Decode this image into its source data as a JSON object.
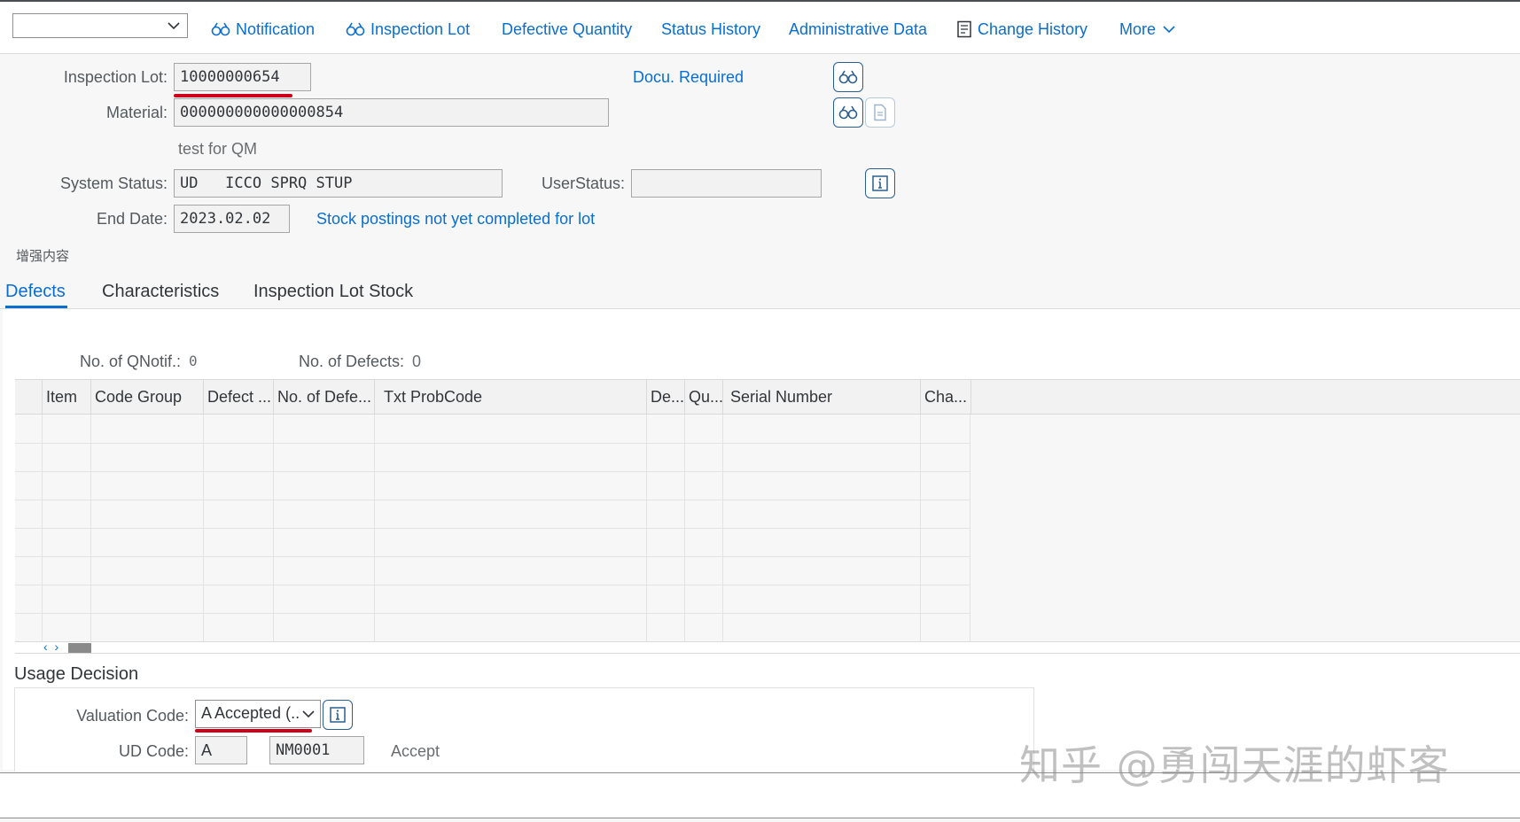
{
  "toolbar": {
    "dropdown_value": "",
    "buttons": [
      {
        "label": "Notification",
        "icon": "binoculars-icon"
      },
      {
        "label": "Inspection Lot",
        "icon": "binoculars-icon"
      },
      {
        "label": "Defective Quantity"
      },
      {
        "label": "Status History"
      },
      {
        "label": "Administrative Data"
      },
      {
        "label": "Change History",
        "icon": "change-document-icon"
      },
      {
        "label": "More",
        "icon": "chevron-down-icon"
      }
    ]
  },
  "header": {
    "inspection_lot_label": "Inspection Lot:",
    "inspection_lot_value": "10000000654",
    "docu_required_link": "Docu. Required",
    "material_label": "Material:",
    "material_value": "000000000000000854",
    "material_description": "test for QM",
    "system_status_label": "System Status:",
    "system_status_value": "UD   ICCO SPRQ STUP",
    "user_status_label": "UserStatus:",
    "user_status_value": "",
    "end_date_label": "End Date:",
    "end_date_value": "2023.02.02",
    "stock_postings_link": "Stock postings not yet completed for lot",
    "enhancement_label": "增强内容"
  },
  "tabs": [
    {
      "label": "Defects",
      "active": true
    },
    {
      "label": "Characteristics",
      "active": false
    },
    {
      "label": "Inspection Lot Stock",
      "active": false
    }
  ],
  "defects": {
    "qnotif_label": "No. of QNotif.:",
    "qnotif_value": "0",
    "defects_label": "No. of Defects:",
    "defects_value": "0",
    "columns": [
      "Item",
      "Code Group",
      "Defect ...",
      "No. of Defe...",
      "Txt ProbCode",
      "De...",
      "Qu...",
      "Serial Number",
      "Cha..."
    ],
    "rows": []
  },
  "usage_decision": {
    "title": "Usage Decision",
    "valuation_code_label": "Valuation Code:",
    "valuation_code_value": "A Accepted (...",
    "ud_code_label": "UD Code:",
    "ud_code_value": "A",
    "ud_code_group": "NM0001",
    "ud_code_text": "Accept"
  },
  "watermark": "知乎 @勇闯天涯的虾客",
  "colors": {
    "accent": "#0a6ed1",
    "highlight_underline": "#d0021b"
  }
}
